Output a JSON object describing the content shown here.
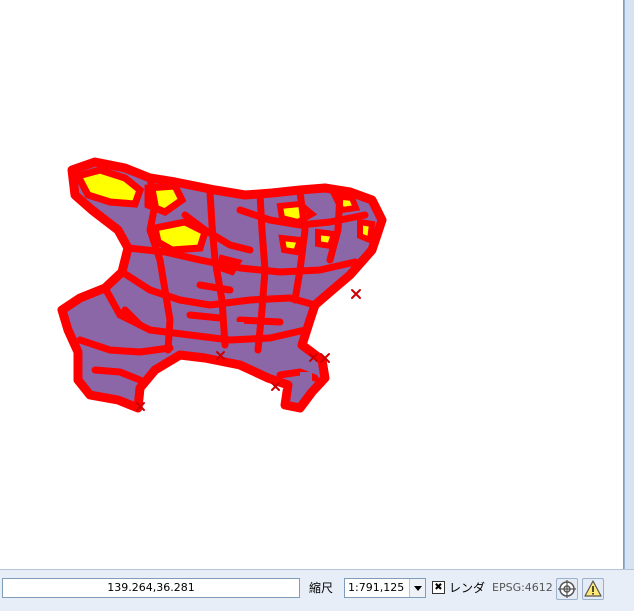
{
  "map": {
    "layers": {
      "fill_low": "#8b67a8",
      "fill_high": "#ffff00",
      "outline": "#ff0000",
      "marker": "#cc0000"
    }
  },
  "status": {
    "coordinate": "139.264,36.281",
    "scale_label": "縮尺",
    "scale_value": "1:791,125",
    "render_checked": true,
    "render_label": "レンダ",
    "crs": "EPSG:4612",
    "projection_icon": "globe-icon",
    "messages_icon": "warning-icon"
  }
}
